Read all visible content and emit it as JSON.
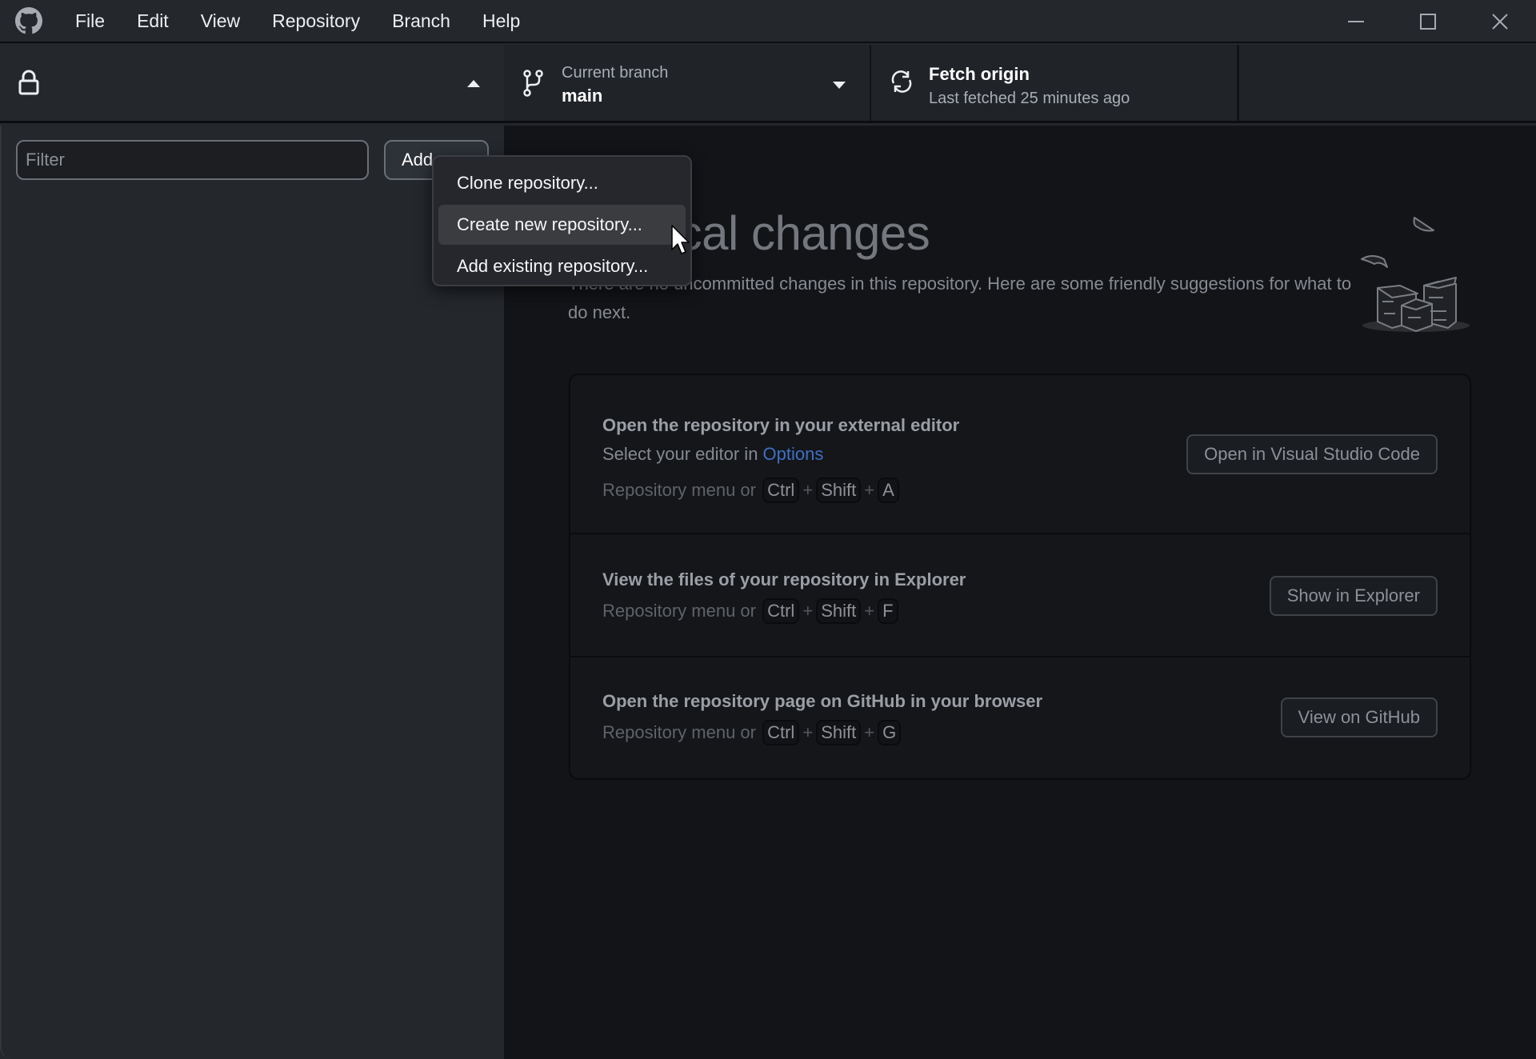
{
  "app": {
    "logo_icon": "github-icon",
    "menu": [
      "File",
      "Edit",
      "View",
      "Repository",
      "Branch",
      "Help"
    ],
    "window_controls": [
      "minimize-icon",
      "maximize-icon",
      "close-icon"
    ]
  },
  "toolbar": {
    "repository": {
      "icon": "lock-icon",
      "expanded": true
    },
    "branch": {
      "label": "Current branch",
      "value": "main"
    },
    "fetch": {
      "title": "Fetch origin",
      "subtitle": "Last fetched 25 minutes ago"
    }
  },
  "sidebar": {
    "filter": {
      "placeholder": "Filter",
      "value": ""
    },
    "add_button": "Add"
  },
  "add_menu": {
    "items": [
      {
        "label": "Clone repository..."
      },
      {
        "label": "Create new repository...",
        "hovered": true
      },
      {
        "label": "Add existing repository..."
      }
    ]
  },
  "main": {
    "heading": "No local changes",
    "description": "There are no uncommitted changes in this repository. Here are some friendly suggestions for what to do next.",
    "suggestions": [
      {
        "title": "Open the repository in your external editor",
        "subtitle_prefix": "Select your editor in ",
        "subtitle_link": "Options",
        "shortcut_prefix": "Repository menu or",
        "keys": [
          "Ctrl",
          "Shift",
          "A"
        ],
        "button": "Open in Visual Studio Code"
      },
      {
        "title": "View the files of your repository in Explorer",
        "shortcut_prefix": "Repository menu or",
        "keys": [
          "Ctrl",
          "Shift",
          "F"
        ],
        "button": "Show in Explorer"
      },
      {
        "title": "Open the repository page on GitHub in your browser",
        "shortcut_prefix": "Repository menu or",
        "keys": [
          "Ctrl",
          "Shift",
          "G"
        ],
        "button": "View on GitHub"
      }
    ],
    "key_separator": "+"
  },
  "colors": {
    "link": "#3f70c4",
    "menu_hover": "#3a3c40"
  }
}
